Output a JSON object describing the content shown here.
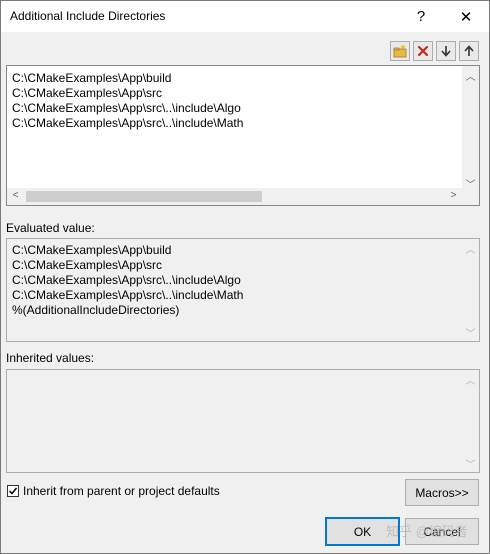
{
  "dialog": {
    "title": "Additional Include Directories",
    "help_glyph": "?",
    "close_glyph": "✕"
  },
  "edit_list": {
    "lines": [
      "C:\\CMakeExamples\\App\\build",
      "C:\\CMakeExamples\\App\\src",
      "C:\\CMakeExamples\\App\\src\\..\\include\\Algo",
      "C:\\CMakeExamples\\App\\src\\..\\include\\Math"
    ]
  },
  "evaluated": {
    "label": "Evaluated value:",
    "lines": [
      "C:\\CMakeExamples\\App\\build",
      "C:\\CMakeExamples\\App\\src",
      "C:\\CMakeExamples\\App\\src\\..\\include\\Algo",
      "C:\\CMakeExamples\\App\\src\\..\\include\\Math",
      "%(AdditionalIncludeDirectories)"
    ]
  },
  "inherited": {
    "label": "Inherited values:",
    "lines": []
  },
  "inherit_checkbox": {
    "label": "Inherit from parent or project defaults",
    "checked": true
  },
  "buttons": {
    "macros": "Macros>>",
    "ok": "OK",
    "cancel": "Cancel"
  },
  "watermark": "知乎 @编码者",
  "colors": {
    "accent": "#0078d7",
    "delete_red": "#c42b1c",
    "folder_yellow": "#e8b64a"
  }
}
